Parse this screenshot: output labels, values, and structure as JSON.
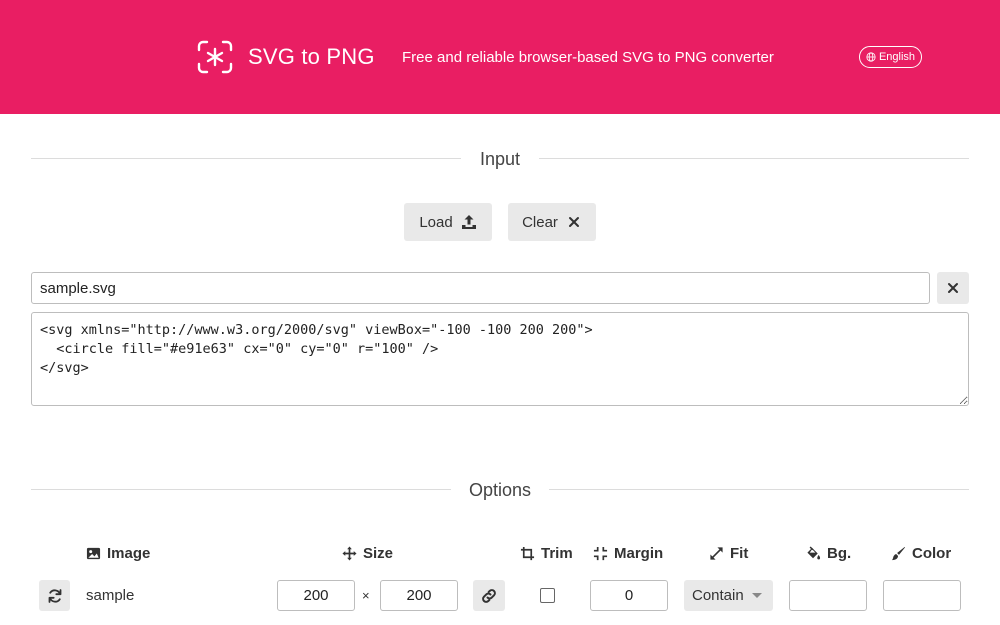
{
  "header": {
    "title": "SVG to PNG",
    "tagline": "Free and reliable browser-based SVG to PNG converter",
    "language": "English",
    "icons": {
      "logo": "focus-asterisk-icon",
      "language": "globe-icon"
    },
    "background_color": "#e91e63"
  },
  "input_section": {
    "title": "Input",
    "load_label": "Load",
    "clear_label": "Clear",
    "icons": {
      "load": "upload-icon",
      "clear": "x-icon",
      "clear_filename": "x-icon"
    },
    "filename_value": "sample.svg",
    "svg_source": "<svg xmlns=\"http://www.w3.org/2000/svg\" viewBox=\"-100 -100 200 200\">\n  <circle fill=\"#e91e63\" cx=\"0\" cy=\"0\" r=\"100\" />\n</svg>"
  },
  "options_section": {
    "title": "Options",
    "headers": {
      "image": "Image",
      "size": "Size",
      "trim": "Trim",
      "margin": "Margin",
      "fit": "Fit",
      "bg": "Bg.",
      "color": "Color"
    },
    "header_icons": {
      "image": "image-icon",
      "size": "move-arrows-icon",
      "trim": "crop-icon",
      "margin": "compress-icon",
      "fit": "expand-icon",
      "bg": "paint-bucket-icon",
      "color": "paintbrush-icon"
    },
    "row": {
      "refresh_icon": "refresh-icon",
      "image_name": "sample",
      "width": "200",
      "times": "×",
      "height": "200",
      "link_icon": "link-icon",
      "trim_checked": false,
      "margin": "0",
      "fit": "Contain",
      "bg_value": "",
      "color_value": ""
    }
  }
}
